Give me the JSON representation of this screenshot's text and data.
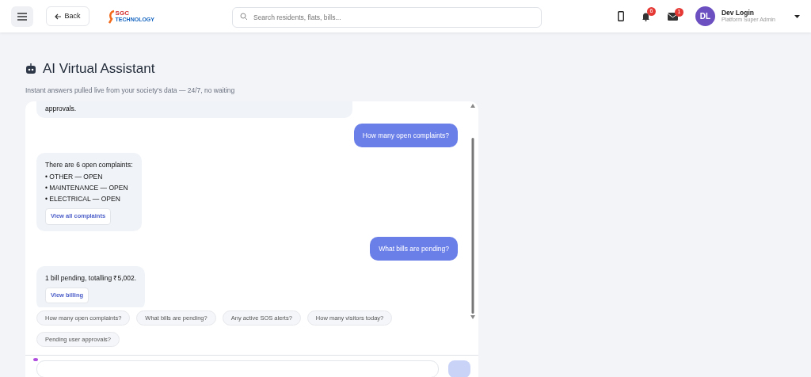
{
  "header": {
    "back_label": "Back",
    "logo_text": "SGC",
    "logo_subtext": "TECHNOLOGY",
    "search": {
      "placeholder": "Search residents, flats, bills..."
    },
    "notifications": {
      "count": "6"
    },
    "messages_badge": {
      "count": "1"
    },
    "user": {
      "initials": "DL",
      "name": "Dev Login",
      "role": "Platform Super Admin"
    }
  },
  "page": {
    "title": "AI Virtual Assistant",
    "subtitle": "Instant answers pulled live from your society's data — 24/7, no waiting"
  },
  "chat": [
    {
      "kind": "bot",
      "lines": [
        "approvals."
      ]
    },
    {
      "kind": "user",
      "lines": [
        "How many open complaints?"
      ]
    },
    {
      "kind": "bot",
      "lines": [
        "There are 6 open complaints:",
        "• OTHER — OPEN",
        "• MAINTENANCE — OPEN",
        "• ELECTRICAL — OPEN"
      ],
      "action": "View all complaints"
    },
    {
      "kind": "user",
      "lines": [
        "What bills are pending?"
      ]
    },
    {
      "kind": "bot",
      "lines": [
        "1 bill pending, totalling ₹5,002."
      ],
      "action": "View billing"
    }
  ],
  "suggestions": [
    "How many open complaints?",
    "What bills are pending?",
    "Any active SOS alerts?",
    "How many visitors today?",
    "Pending user approvals?"
  ]
}
